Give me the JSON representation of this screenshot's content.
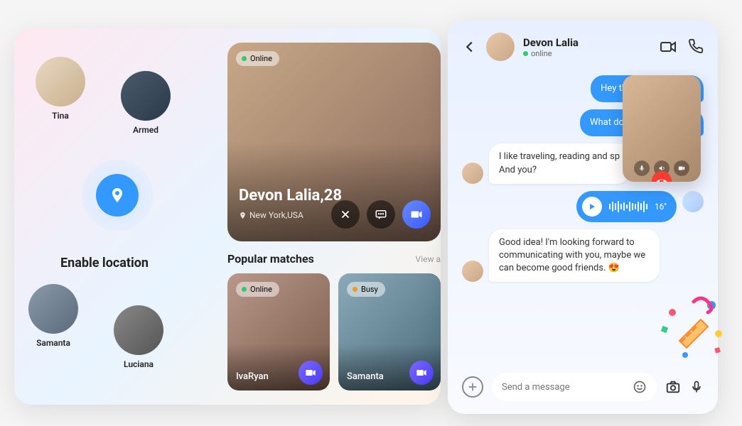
{
  "location": {
    "title": "Enable location",
    "users": [
      {
        "name": "Tina"
      },
      {
        "name": "Armed"
      },
      {
        "name": "Samanta"
      },
      {
        "name": "Luciana"
      }
    ]
  },
  "featured": {
    "status": "Online",
    "name_age": "Devon Lalia,28",
    "location": "New York,USA"
  },
  "popular": {
    "title": "Popular matches",
    "view_all": "View a",
    "cards": [
      {
        "name": "IvaRyan",
        "status": "Online",
        "status_type": "online"
      },
      {
        "name": "Samanta",
        "status": "Busy",
        "status_type": "busy"
      }
    ]
  },
  "chat": {
    "header": {
      "name": "Devon Lalia",
      "status": "online"
    },
    "messages": {
      "m1": "Hey there! Nice to mee",
      "m2": "What do you usually like t",
      "m3": "I like traveling, reading and sp\nAnd you?",
      "voice_duration": "16''",
      "m4": "Good idea! I'm looking forward to communicating with you, maybe we can become good friends. 😍"
    },
    "input_placeholder": "Send a message"
  }
}
